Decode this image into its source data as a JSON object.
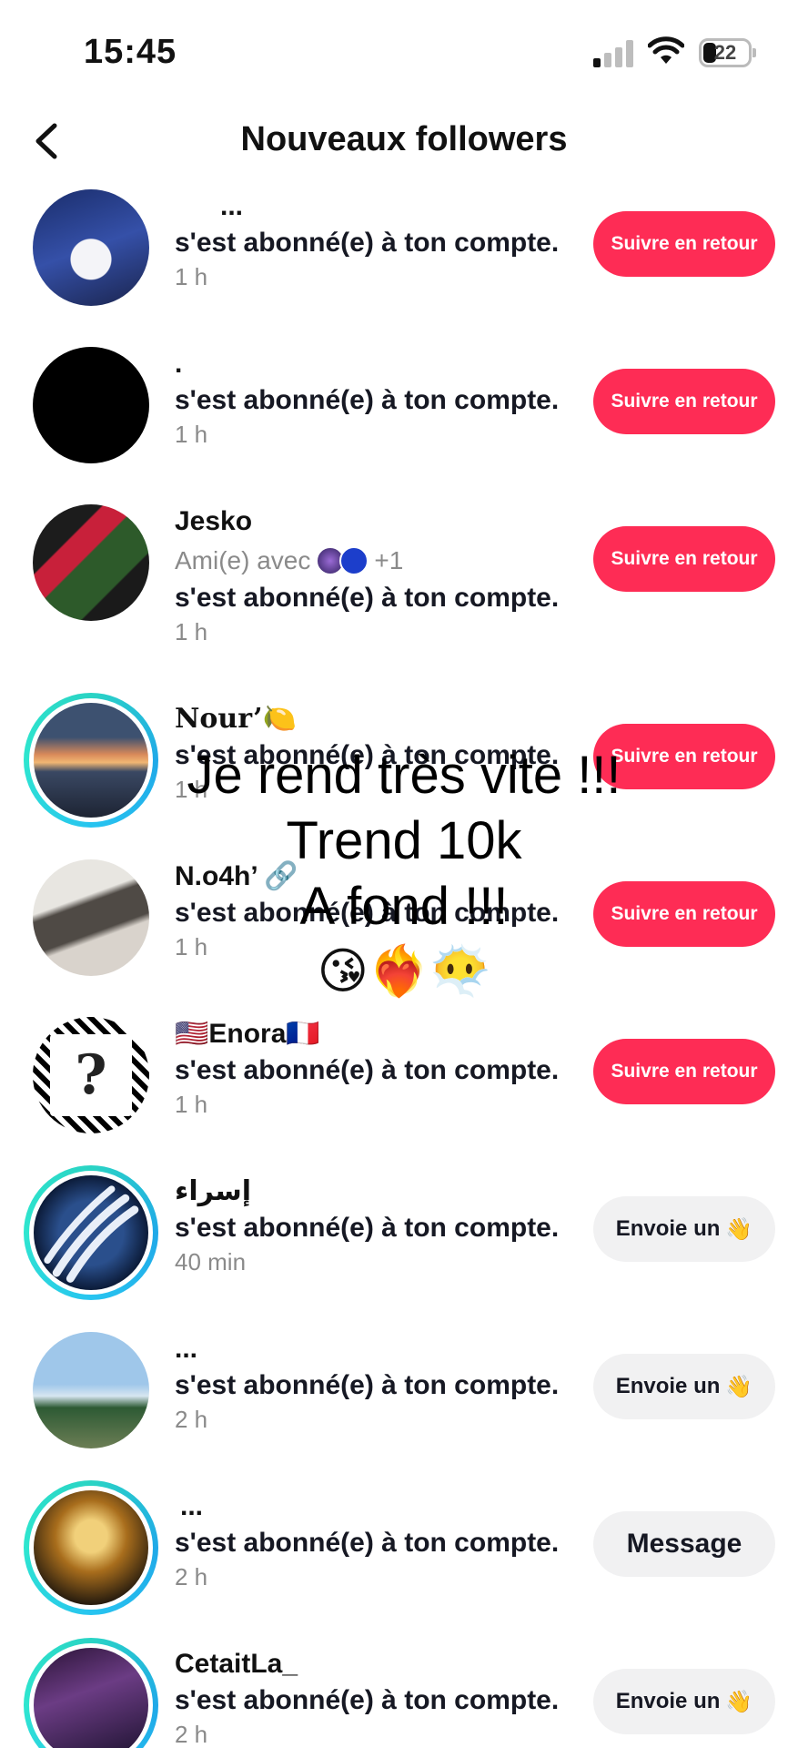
{
  "status_bar": {
    "time": "15:45",
    "battery": "22"
  },
  "header": {
    "title": "Nouveaux followers"
  },
  "followers": [
    {
      "username": "...",
      "action": "s'est abonné(e) à ton compte.",
      "time": "1 h",
      "button": "Suivre en retour"
    },
    {
      "username": ".",
      "action": "s'est abonné(e) à ton compte.",
      "time": "1 h",
      "button": "Suivre en retour"
    },
    {
      "username": "Jesko",
      "mutual": "Ami(e) avec",
      "mutual_extra": "+1",
      "action": "s'est abonné(e) à ton compte.",
      "time": "1 h",
      "button": "Suivre en retour"
    },
    {
      "username": "Nour’🍋",
      "action": "s'est abonné(e) à ton compte.",
      "time": "1 h",
      "button": "Suivre en retour"
    },
    {
      "username": "N.o4h’ 🔗",
      "action": "s'est abonné(e) à ton compte.",
      "time": "1 h",
      "button": "Suivre en retour"
    },
    {
      "username": "🇺🇸Enora🇫🇷",
      "action": "s'est abonné(e) à ton compte.",
      "time": "1 h",
      "button": "Suivre en retour"
    },
    {
      "username": "إسراء",
      "action": "s'est abonné(e) à ton compte.",
      "time": "40 min",
      "button": "Envoie un",
      "button_emoji": "👋"
    },
    {
      "username": "...",
      "action": "s'est abonné(e) à ton compte.",
      "time": "2 h",
      "button": "Envoie un",
      "button_emoji": "👋"
    },
    {
      "username": "...",
      "action": "s'est abonné(e) à ton compte.",
      "time": "2 h",
      "button": "Message"
    },
    {
      "username": "CetaitLa_",
      "action": "s'est abonné(e) à ton compte.",
      "time": "2 h",
      "button": "Envoie un",
      "button_emoji": "👋"
    }
  ],
  "overlay": {
    "line1": "Je rend très vite !!!",
    "line2": "Trend 10k",
    "line3": "A fond !!!",
    "emojis": "😘❤️‍🔥😶‍🌫️"
  },
  "colors": {
    "primary": "#fe2c55",
    "ring": "#2ad4c4",
    "muted": "#8a8a8a"
  }
}
